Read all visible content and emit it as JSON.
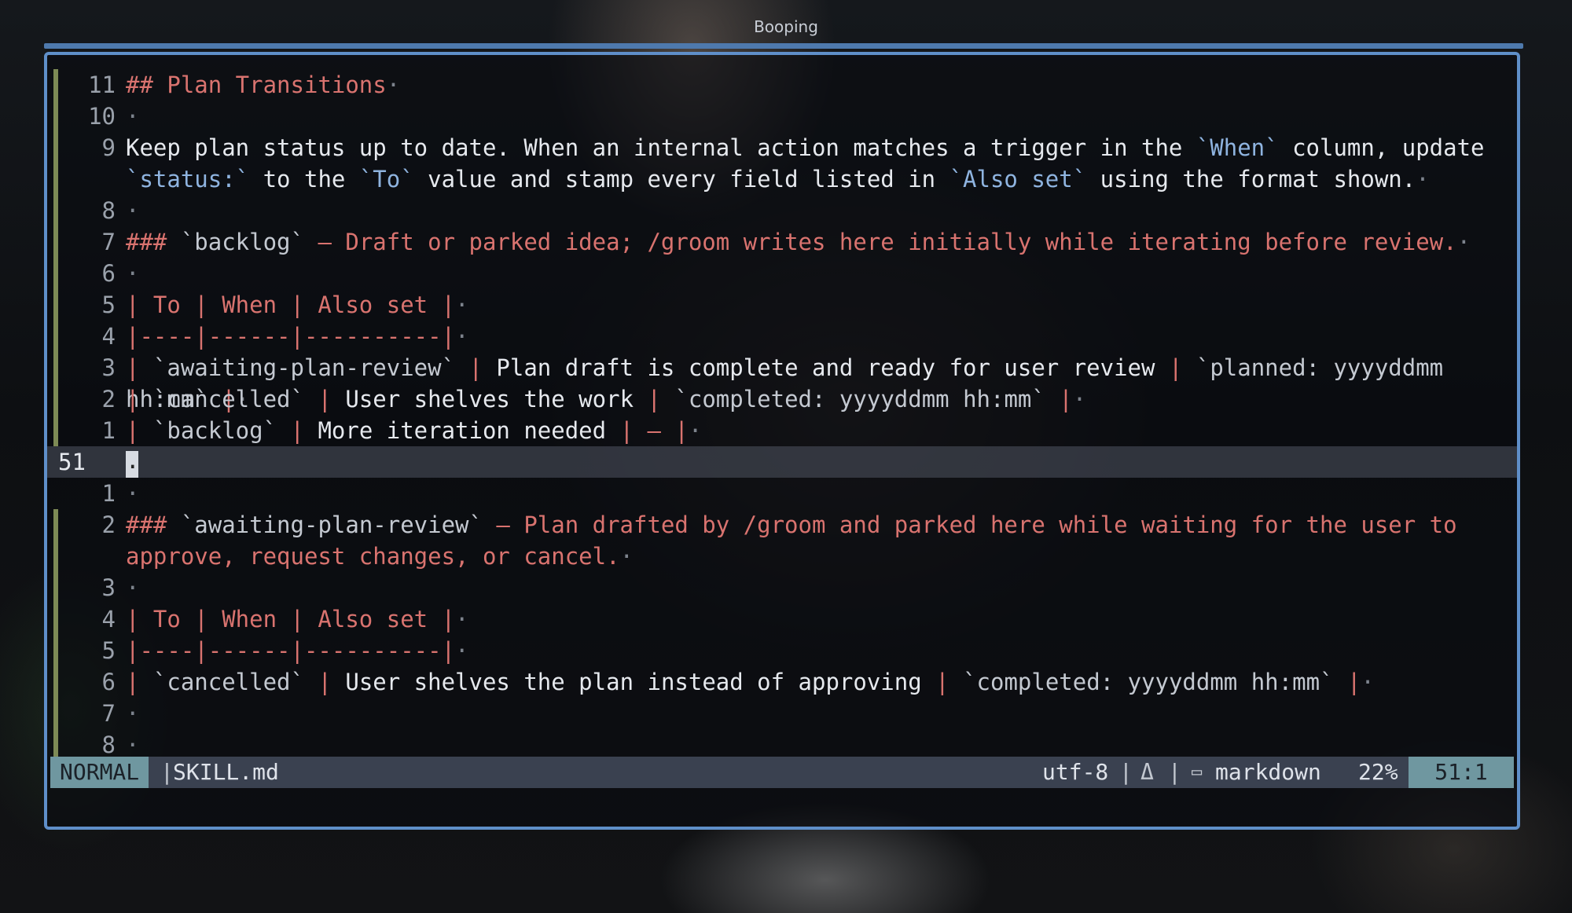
{
  "window": {
    "title": "Booping"
  },
  "editor": {
    "lines": [
      {
        "num": "11",
        "marker": true,
        "segments": [
          {
            "t": "## Plan Transitions",
            "c": "h"
          },
          {
            "t": "·",
            "c": "dot"
          }
        ]
      },
      {
        "num": "10",
        "marker": true,
        "segments": [
          {
            "t": "·",
            "c": "dot"
          }
        ]
      },
      {
        "num": "9",
        "marker": true,
        "wrap": true,
        "segments": [
          {
            "t": "Keep plan status up to date. When an internal action matches a trigger in the ",
            "c": "txt"
          },
          {
            "t": "`When`",
            "c": "code"
          },
          {
            "t": " column, update ",
            "c": "txt"
          },
          {
            "t": "`status:`",
            "c": "code"
          },
          {
            "t": " to the ",
            "c": "txt"
          },
          {
            "t": "`To`",
            "c": "code"
          },
          {
            "t": " value and stamp every field listed in ",
            "c": "txt"
          },
          {
            "t": "`Also set`",
            "c": "code"
          },
          {
            "t": " using the format shown.",
            "c": "txt"
          },
          {
            "t": "·",
            "c": "dot"
          }
        ]
      },
      {
        "num": "8",
        "marker": true,
        "segments": [
          {
            "t": "·",
            "c": "dot"
          }
        ]
      },
      {
        "num": "7",
        "marker": true,
        "segments": [
          {
            "t": "### ",
            "c": "h"
          },
          {
            "t": "`backlog`",
            "c": "tick"
          },
          {
            "t": " — Draft or parked idea; /groom writes here initially while iterating before review.",
            "c": "h"
          },
          {
            "t": "·",
            "c": "dot"
          }
        ]
      },
      {
        "num": "6",
        "marker": true,
        "segments": [
          {
            "t": "·",
            "c": "dot"
          }
        ]
      },
      {
        "num": "5",
        "marker": true,
        "segments": [
          {
            "t": "| To | When | Also set |",
            "c": "h"
          },
          {
            "t": "·",
            "c": "dot"
          }
        ]
      },
      {
        "num": "4",
        "marker": true,
        "segments": [
          {
            "t": "|----|------|----------|",
            "c": "h"
          },
          {
            "t": "·",
            "c": "dot"
          }
        ]
      },
      {
        "num": "3",
        "marker": true,
        "segments": [
          {
            "t": "| ",
            "c": "pipe"
          },
          {
            "t": "`awaiting-plan-review`",
            "c": "tick"
          },
          {
            "t": " | ",
            "c": "pipe"
          },
          {
            "t": "Plan draft is complete and ready for user review",
            "c": "txt"
          },
          {
            "t": " | ",
            "c": "pipe"
          },
          {
            "t": "`planned: yyyyddmm hh:mm`",
            "c": "tick"
          },
          {
            "t": " |",
            "c": "pipe"
          },
          {
            "t": "·",
            "c": "dot"
          }
        ]
      },
      {
        "num": "2",
        "marker": true,
        "segments": [
          {
            "t": "| ",
            "c": "pipe"
          },
          {
            "t": "`cancelled`",
            "c": "tick"
          },
          {
            "t": " | ",
            "c": "pipe"
          },
          {
            "t": "User shelves the work",
            "c": "txt"
          },
          {
            "t": " | ",
            "c": "pipe"
          },
          {
            "t": "`completed: yyyyddmm hh:mm`",
            "c": "tick"
          },
          {
            "t": " |",
            "c": "pipe"
          },
          {
            "t": "·",
            "c": "dot"
          }
        ]
      },
      {
        "num": "1",
        "marker": true,
        "segments": [
          {
            "t": "| ",
            "c": "pipe"
          },
          {
            "t": "`backlog`",
            "c": "tick"
          },
          {
            "t": " | ",
            "c": "pipe"
          },
          {
            "t": "More iteration needed",
            "c": "txt"
          },
          {
            "t": " | — |",
            "c": "pipe"
          },
          {
            "t": "·",
            "c": "dot"
          }
        ]
      },
      {
        "num": "51",
        "current": true,
        "segments": [
          {
            "t": "·",
            "c": "cursor"
          }
        ]
      },
      {
        "num": "1",
        "marker": false,
        "segments": [
          {
            "t": "·",
            "c": "dot"
          }
        ]
      },
      {
        "num": "2",
        "marker": true,
        "wrap": true,
        "segments": [
          {
            "t": "### ",
            "c": "h"
          },
          {
            "t": "`awaiting-plan-review`",
            "c": "tick"
          },
          {
            "t": " — Plan drafted by /groom and parked here while waiting for the user to approve, request changes, or cancel.",
            "c": "h"
          },
          {
            "t": "·",
            "c": "dot"
          }
        ]
      },
      {
        "num": "3",
        "marker": true,
        "segments": [
          {
            "t": "·",
            "c": "dot"
          }
        ]
      },
      {
        "num": "4",
        "marker": true,
        "segments": [
          {
            "t": "| To | When | Also set |",
            "c": "h"
          },
          {
            "t": "·",
            "c": "dot"
          }
        ]
      },
      {
        "num": "5",
        "marker": true,
        "segments": [
          {
            "t": "|----|------|----------|",
            "c": "h"
          },
          {
            "t": "·",
            "c": "dot"
          }
        ]
      },
      {
        "num": "6",
        "marker": true,
        "segments": [
          {
            "t": "| ",
            "c": "pipe"
          },
          {
            "t": "`cancelled`",
            "c": "tick"
          },
          {
            "t": " | ",
            "c": "pipe"
          },
          {
            "t": "User shelves the plan instead of approving",
            "c": "txt"
          },
          {
            "t": " | ",
            "c": "pipe"
          },
          {
            "t": "`completed: yyyyddmm hh:mm`",
            "c": "tick"
          },
          {
            "t": " |",
            "c": "pipe"
          },
          {
            "t": "·",
            "c": "dot"
          }
        ]
      },
      {
        "num": "7",
        "marker": true,
        "segments": [
          {
            "t": "·",
            "c": "dot"
          }
        ]
      },
      {
        "num": "8",
        "marker": true,
        "segments": [
          {
            "t": "·",
            "c": "dot"
          }
        ]
      }
    ]
  },
  "statusline": {
    "mode": "NORMAL",
    "sep": "|",
    "file": "SKILL.md",
    "encoding": "utf-8",
    "fileformat_icon": "linux-tux-icon",
    "fileformat_glyph": "Δ",
    "filetype_icon": "markdown-icon",
    "filetype_glyph": "▭",
    "filetype": "markdown",
    "percent": "22%",
    "position": "51:1"
  },
  "colors": {
    "border": "#5f8fc9",
    "heading": "#d9736f",
    "code": "#8fb4e0",
    "mode_bg": "#6f97a0",
    "status_bg": "#3a4150",
    "gutter_marker": "#7d8a55"
  }
}
